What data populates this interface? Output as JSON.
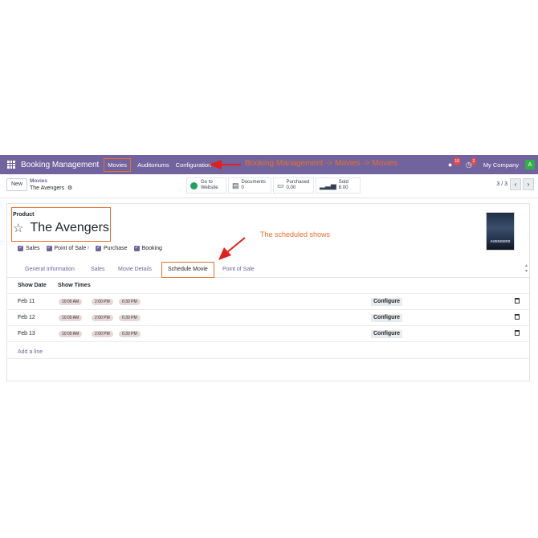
{
  "navbar": {
    "brand": "Booking Management",
    "menu": [
      "Movies",
      "Auditoriums",
      "Configuration"
    ],
    "discuss_count": "10",
    "activity_count": "2",
    "company": "My Company",
    "avatar_letter": "A"
  },
  "annotations": {
    "nav_path": "Booking Management -> Movies -> Movies",
    "scheduled": "The scheduled shows",
    "color": "#e8702a"
  },
  "control": {
    "new_label": "New",
    "breadcrumb_parent": "Movies",
    "breadcrumb_current": "The Avengers",
    "smart_buttons": {
      "website_l1": "Go to",
      "website_l2": "Website",
      "documents_l1": "Documents",
      "documents_l2": "0",
      "purchased_l1": "Purchased",
      "purchased_l2": "0.00",
      "sold_l1": "Sold",
      "sold_l2": "6.00"
    },
    "pager": "3 / 3"
  },
  "form": {
    "product_label": "Product",
    "product_name": "The Avengers",
    "poster_text": "AVENGERS",
    "checkboxes": [
      "Sales",
      "Point of Sale",
      "Purchase",
      "Booking"
    ],
    "pos_help": "?",
    "tabs": [
      "General Information",
      "Sales",
      "Movie Details",
      "Schedule Movie",
      "Point of Sale"
    ],
    "active_tab": "Schedule Movie",
    "table": {
      "headers": [
        "Show Date",
        "Show Times"
      ],
      "rows": [
        {
          "date": "Feb 11",
          "times": [
            "10:00 AM",
            "2:00 PM",
            "6:30 PM"
          ],
          "action": "Configure"
        },
        {
          "date": "Feb 12",
          "times": [
            "10:00 AM",
            "2:00 PM",
            "6:30 PM"
          ],
          "action": "Configure"
        },
        {
          "date": "Feb 13",
          "times": [
            "10:00 AM",
            "2:00 PM",
            "6:30 PM"
          ],
          "action": "Configure"
        }
      ],
      "add_line": "Add a line"
    }
  },
  "colors": {
    "brand": "#71639e",
    "highlight": "#e8702a",
    "arrow": "#e0201c"
  }
}
